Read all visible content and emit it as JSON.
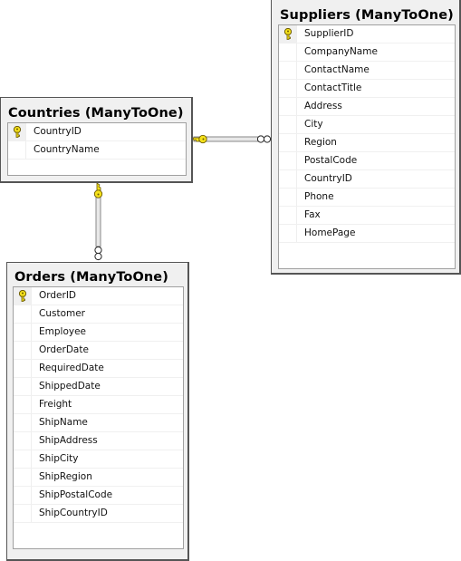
{
  "tables": {
    "countries": {
      "title": "Countries (ManyToOne)",
      "columns": [
        {
          "name": "CountryID",
          "primary_key": true
        },
        {
          "name": "CountryName",
          "primary_key": false
        }
      ]
    },
    "suppliers": {
      "title": "Suppliers (ManyToOne)",
      "columns": [
        {
          "name": "SupplierID",
          "primary_key": true
        },
        {
          "name": "CompanyName",
          "primary_key": false
        },
        {
          "name": "ContactName",
          "primary_key": false
        },
        {
          "name": "ContactTitle",
          "primary_key": false
        },
        {
          "name": "Address",
          "primary_key": false
        },
        {
          "name": "City",
          "primary_key": false
        },
        {
          "name": "Region",
          "primary_key": false
        },
        {
          "name": "PostalCode",
          "primary_key": false
        },
        {
          "name": "CountryID",
          "primary_key": false
        },
        {
          "name": "Phone",
          "primary_key": false
        },
        {
          "name": "Fax",
          "primary_key": false
        },
        {
          "name": "HomePage",
          "primary_key": false
        }
      ]
    },
    "orders": {
      "title": "Orders (ManyToOne)",
      "columns": [
        {
          "name": "OrderID",
          "primary_key": true
        },
        {
          "name": "Customer",
          "primary_key": false
        },
        {
          "name": "Employee",
          "primary_key": false
        },
        {
          "name": "OrderDate",
          "primary_key": false
        },
        {
          "name": "RequiredDate",
          "primary_key": false
        },
        {
          "name": "ShippedDate",
          "primary_key": false
        },
        {
          "name": "Freight",
          "primary_key": false
        },
        {
          "name": "ShipName",
          "primary_key": false
        },
        {
          "name": "ShipAddress",
          "primary_key": false
        },
        {
          "name": "ShipCity",
          "primary_key": false
        },
        {
          "name": "ShipRegion",
          "primary_key": false
        },
        {
          "name": "ShipPostalCode",
          "primary_key": false
        },
        {
          "name": "ShipCountryID",
          "primary_key": false
        }
      ]
    }
  },
  "relationships": [
    {
      "from": "countries",
      "to": "suppliers",
      "one_end": "key-icon",
      "many_end": "infinity-icon"
    },
    {
      "from": "countries",
      "to": "orders",
      "one_end": "key-icon",
      "many_end": "infinity-icon"
    }
  ],
  "colors": {
    "key_fill": "#f5e11a",
    "key_stroke": "#6b5a00",
    "box_bg": "#f0f0f0",
    "line": "#8a8a8a"
  }
}
